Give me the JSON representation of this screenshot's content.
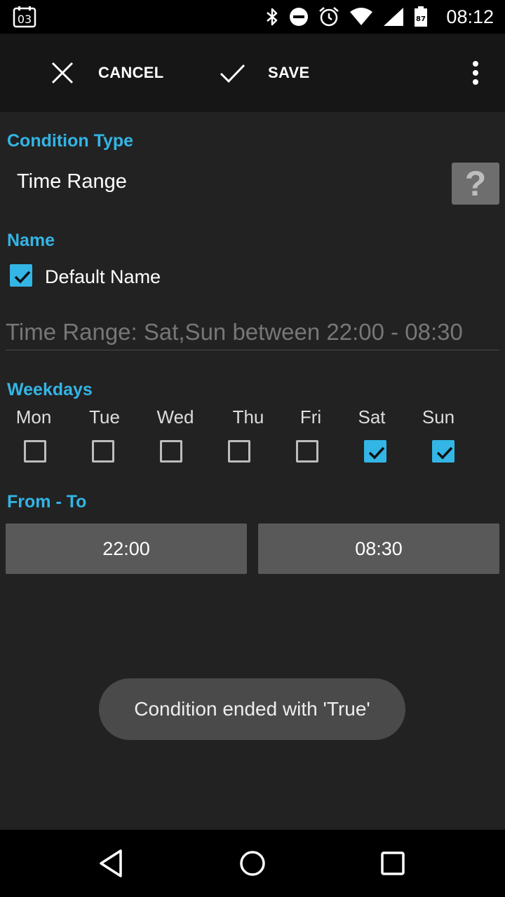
{
  "status_bar": {
    "calendar_day": "03",
    "battery_level": "87",
    "time": "08:12",
    "icons": [
      "calendar-icon",
      "bluetooth-icon",
      "do-not-disturb-icon",
      "alarm-icon",
      "wifi-icon",
      "signal-icon",
      "battery-icon"
    ]
  },
  "toolbar": {
    "cancel_label": "CANCEL",
    "save_label": "SAVE"
  },
  "condition_type": {
    "title": "Condition Type",
    "value": "Time Range",
    "help_label": "?"
  },
  "name": {
    "title": "Name",
    "default_label": "Default Name",
    "default_checked": true,
    "field_value": "Time Range: Sat,Sun between 22:00 - 08:30"
  },
  "weekdays": {
    "title": "Weekdays",
    "days": [
      {
        "label": "Mon",
        "checked": false
      },
      {
        "label": "Tue",
        "checked": false
      },
      {
        "label": "Wed",
        "checked": false
      },
      {
        "label": "Thu",
        "checked": false
      },
      {
        "label": "Fri",
        "checked": false
      },
      {
        "label": "Sat",
        "checked": true
      },
      {
        "label": "Sun",
        "checked": true
      }
    ]
  },
  "from_to": {
    "title": "From - To",
    "from": "22:00",
    "to": "08:30"
  },
  "toast": {
    "message": "Condition ended with 'True'"
  },
  "colors": {
    "accent": "#33b5e5",
    "background": "#222222",
    "button": "#595959"
  }
}
